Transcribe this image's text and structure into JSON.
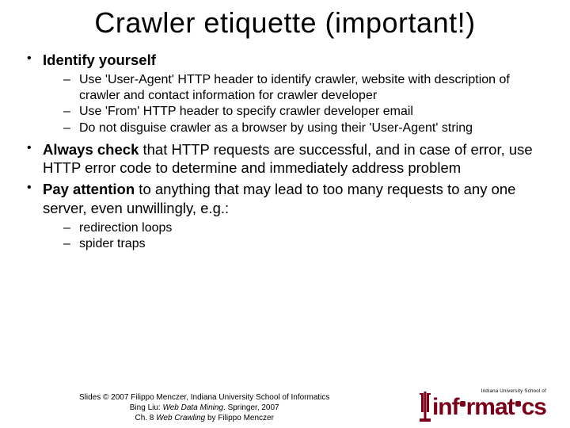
{
  "title": "Crawler etiquette (important!)",
  "bullets": {
    "b1_bold": "Identify yourself",
    "b1_sub": [
      "Use 'User-Agent' HTTP header to identify crawler, website with description of crawler and contact information for crawler developer",
      "Use 'From' HTTP header to specify crawler developer email",
      "Do not disguise crawler as a browser by using their 'User-Agent' string"
    ],
    "b2_bold": "Always check",
    "b2_rest": " that HTTP requests are successful, and in case of error, use HTTP error code to determine and immediately address problem",
    "b3_bold": "Pay attention",
    "b3_rest": " to anything that may lead to too many requests to any one server, even unwillingly, e.g.:",
    "b3_sub": [
      "redirection loops",
      "spider traps"
    ]
  },
  "footer": {
    "line1": "Slides © 2007 Filippo Menczer, Indiana University School of Informatics",
    "line2a": "Bing Liu: ",
    "line2b": "Web Data Mining",
    "line2c": ". Springer, 2007",
    "line3a": "Ch. 8 ",
    "line3b": "Web Crawling",
    "line3c": " by Filippo Menczer"
  },
  "logo": {
    "superscript": "Indiana University School of",
    "word_pre": "inf",
    "word_mid": "rmat",
    "word_post": "cs"
  }
}
